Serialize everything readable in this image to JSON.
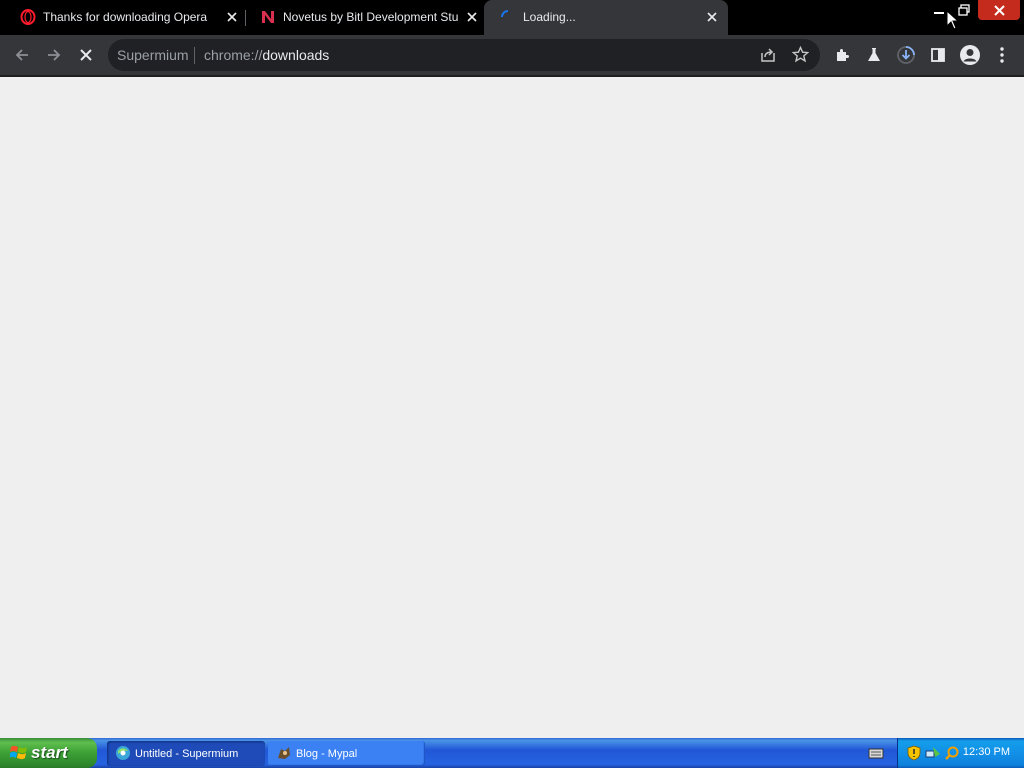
{
  "tabs": [
    {
      "title": "Thanks for downloading Opera",
      "icon": "opera-icon",
      "active": false
    },
    {
      "title": "Novetus by Bitl Development Studio",
      "icon": "novetus-icon",
      "active": false
    },
    {
      "title": "Loading...",
      "icon": "loading-spinner-icon",
      "active": true
    }
  ],
  "window_controls": [
    "minimize-icon",
    "restore-icon",
    "close-icon"
  ],
  "toolbar": {
    "omnibox": {
      "chip": "Supermium",
      "url_scheme": "chrome://",
      "url_host": "downloads"
    },
    "icons": [
      "back-arrow-icon",
      "forward-arrow-icon",
      "stop-icon",
      "share-icon",
      "star-icon",
      "extensions-icon",
      "labs-flask-icon",
      "download-progress-icon",
      "side-panel-icon",
      "profile-avatar-icon",
      "kebab-menu-icon"
    ]
  },
  "taskbar": {
    "start_label": "start",
    "buttons": [
      {
        "label": "Untitled - Supermium",
        "icon": "supermium-icon",
        "active": true
      },
      {
        "label": "Blog - Mypal",
        "icon": "mypal-icon",
        "active": false
      }
    ],
    "tray_icons": [
      "keyboard-icon",
      "security-shield-icon",
      "network-icon",
      "search-icon"
    ],
    "clock": "12:30 PM"
  },
  "colors": {
    "tabstrip": "#000000",
    "toolbar": "#35363a",
    "page_bg": "#efefef",
    "accent_download": "#8ab4f8",
    "taskbar_blue": "#245edb",
    "start_green": "#3c9f35"
  }
}
